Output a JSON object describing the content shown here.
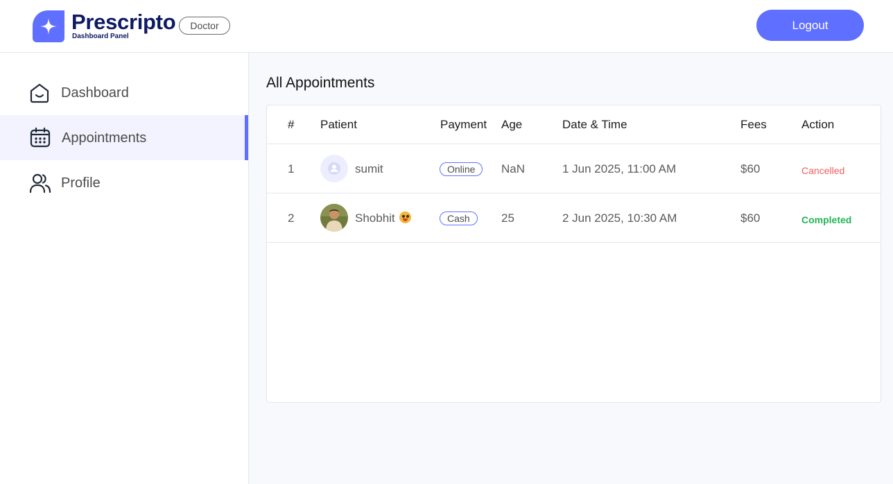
{
  "header": {
    "brand": "Prescripto",
    "subtitle": "Dashboard Panel",
    "role_badge": "Doctor",
    "logout_label": "Logout"
  },
  "sidebar": {
    "items": [
      {
        "label": "Dashboard",
        "icon": "home-icon",
        "active": false
      },
      {
        "label": "Appointments",
        "icon": "calendar-icon",
        "active": true
      },
      {
        "label": "Profile",
        "icon": "users-icon",
        "active": false
      }
    ]
  },
  "main": {
    "title": "All Appointments",
    "table": {
      "columns": [
        "#",
        "Patient",
        "Payment",
        "Age",
        "Date & Time",
        "Fees",
        "Action"
      ],
      "rows": [
        {
          "index": "1",
          "patient": "sumit",
          "avatar": "default-avatar-icon",
          "payment": "Online",
          "age": "NaN",
          "datetime": "1 Jun 2025, 11:00 AM",
          "fees": "$60",
          "action": "Cancelled"
        },
        {
          "index": "2",
          "patient": "Shobhit",
          "avatar": "photo-avatar",
          "payment": "Cash",
          "age": "25",
          "datetime": "2 Jun 2025, 10:30 AM",
          "fees": "$60",
          "action": "Completed"
        }
      ]
    }
  },
  "colors": {
    "accent": "#5f6fff",
    "brand_text": "#0e1a63",
    "cancelled": "#f25c5c",
    "completed": "#22b456",
    "active_nav_bg": "#f2f3ff"
  }
}
